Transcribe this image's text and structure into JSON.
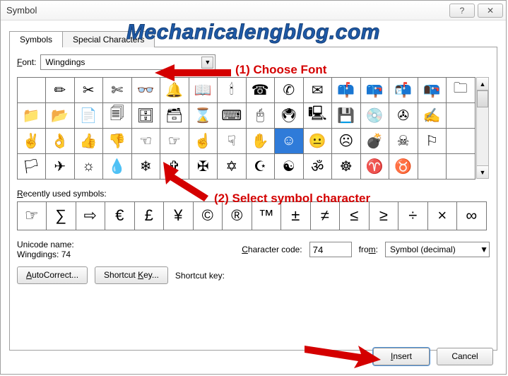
{
  "title": "Symbol",
  "tabs": {
    "symbols": "Symbols",
    "special": "Special Characters"
  },
  "font_label": "Font:",
  "font_value": "Wingdings",
  "recent_label": "Recently used symbols:",
  "unicode_name_label": "Unicode name:",
  "unicode_name_value": "Wingdings: 74",
  "char_code_label": "Character code:",
  "char_code_value": "74",
  "from_label": "from:",
  "from_value": "Symbol (decimal)",
  "autocorrect": "AutoCorrect...",
  "shortcut_key_btn": "Shortcut Key...",
  "shortcut_key_label": "Shortcut key:",
  "insert_btn": "Insert",
  "cancel_btn": "Cancel",
  "watermark": "Mechanicalengblog.com",
  "anno1": "(1) Choose Font",
  "anno2": "(2) Select symbol character",
  "grid": [
    "",
    "✏",
    "✂",
    "✄",
    "👓",
    "🔔",
    "📖",
    "🕯",
    "☎",
    "✆",
    "✉",
    "📫",
    "📪",
    "📬",
    "📭",
    "🗀",
    "📁",
    "📂",
    "📄",
    "🗐",
    "🗄",
    "🗃",
    "⌛",
    "⌨",
    "🖰",
    "🖲",
    "🖳",
    "💾",
    "💿",
    "✇",
    "✍",
    "",
    "✌",
    "👌",
    "👍",
    "👎",
    "☜",
    "☞",
    "☝",
    "☟",
    "✋",
    "☺",
    "😐",
    "☹",
    "💣",
    "☠",
    "⚐",
    "",
    "🏳",
    "✈",
    "☼",
    "💧",
    "❄",
    "✞",
    "✠",
    "✡",
    "☪",
    "☯",
    "ॐ",
    "☸",
    "♈",
    "♉",
    "",
    ""
  ],
  "selected_index": 41,
  "recent": [
    "☞",
    "∑",
    "⇨",
    "€",
    "£",
    "¥",
    "©",
    "®",
    "™",
    "±",
    "≠",
    "≤",
    "≥",
    "÷",
    "×",
    "∞"
  ],
  "chart_data": null
}
